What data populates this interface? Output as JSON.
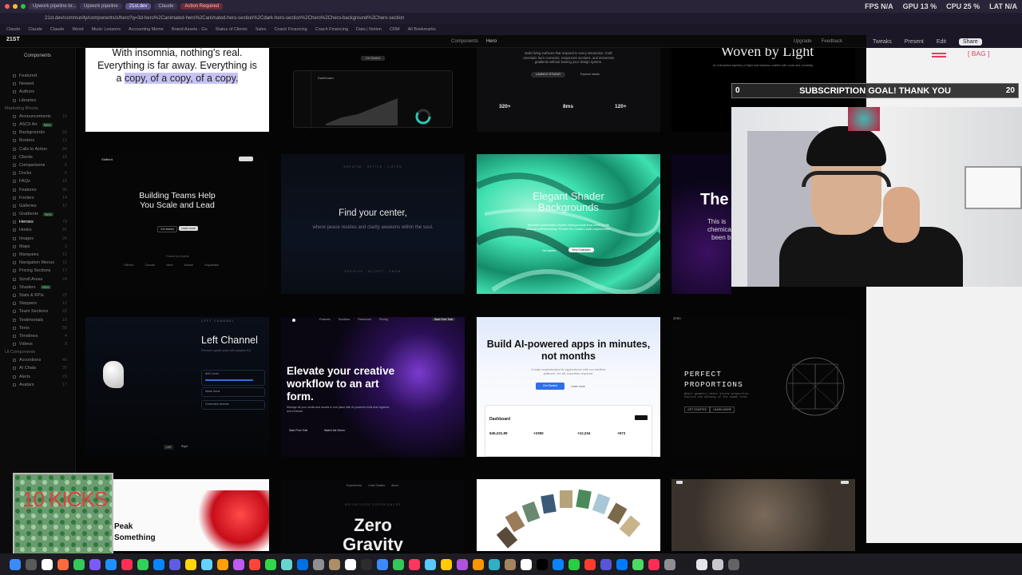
{
  "browser": {
    "tabs": [
      "Upwork pipeline br...",
      "Upwork pipeline",
      "21st.dev",
      "Claude",
      "Action Required"
    ],
    "address": "21st.dev/community/components/s/hero?q=3d-hero%2Canimated-hero%2Canimated-hero-section%2Cdark-hero-section%2Chero%2Chero-background%2Chero-section",
    "bookmarks": [
      "Claude",
      "Claude",
      "Claude",
      "Weird",
      "Music Lessons",
      "Accounting Meme",
      "Brand Assets - Go",
      "Status of Clients",
      "Sales",
      "Coach Financing",
      "Coach Financing",
      "Data | Notion",
      "CRM",
      "All Bookmarks"
    ],
    "stats": {
      "fps": "FPS N/A",
      "gpu": "GPU 13 %",
      "cpu": "CPU 25 %",
      "lat": "LAT N/A"
    }
  },
  "site": {
    "logo": "21ST",
    "breadcrumb": [
      "Components",
      "Hero"
    ],
    "header_right": [
      "Upgrade",
      "Feedback"
    ]
  },
  "sidebar": {
    "top_label": "Components",
    "items": [
      {
        "label": "Featured"
      },
      {
        "label": "Newest"
      },
      {
        "label": "Authors"
      },
      {
        "label": "Libraries"
      }
    ],
    "section_marketing": "Marketing Blocks",
    "marketing": [
      {
        "label": "Announcements",
        "count": "10"
      },
      {
        "label": "ASCII Art",
        "badge": "New"
      },
      {
        "label": "Backgrounds",
        "count": "33"
      },
      {
        "label": "Borders",
        "count": "12"
      },
      {
        "label": "Calls to Action",
        "count": "34"
      },
      {
        "label": "Clients",
        "count": "16"
      },
      {
        "label": "Comparisons",
        "count": "6"
      },
      {
        "label": "Docks",
        "count": "6"
      },
      {
        "label": "FAQs",
        "count": "18"
      },
      {
        "label": "Features",
        "count": "36"
      },
      {
        "label": "Footers",
        "count": "14"
      },
      {
        "label": "Galleries",
        "count": "12"
      },
      {
        "label": "Gradients",
        "badge": "New"
      },
      {
        "label": "Heroes",
        "count": "73",
        "active": true
      },
      {
        "label": "Hooks",
        "count": "31"
      },
      {
        "label": "Images",
        "count": "26"
      },
      {
        "label": "Maps",
        "count": "2"
      },
      {
        "label": "Marquees",
        "count": "12"
      },
      {
        "label": "Navigation Menus",
        "count": "11"
      },
      {
        "label": "Pricing Sections",
        "count": "17"
      },
      {
        "label": "Scroll Areas",
        "count": "24"
      },
      {
        "label": "Shaders",
        "badge": "New"
      },
      {
        "label": "Stats & KPIs",
        "count": "22"
      },
      {
        "label": "Steppers",
        "count": "12"
      },
      {
        "label": "Team Sections",
        "count": "22"
      },
      {
        "label": "Testimonials",
        "count": "15"
      },
      {
        "label": "Texts",
        "count": "58"
      },
      {
        "label": "Timelines",
        "count": "4"
      },
      {
        "label": "Videos",
        "count": "8"
      }
    ],
    "section_ui": "UI Components",
    "ui": [
      {
        "label": "Accordions",
        "count": "40"
      },
      {
        "label": "AI Chats",
        "count": "30"
      },
      {
        "label": "Alerts",
        "count": "23"
      },
      {
        "label": "Avatars",
        "count": "17"
      }
    ]
  },
  "cards": {
    "r0c0": {
      "line1": "With insomnia, nothing's real.",
      "line2": "Everything is far away. Everything is",
      "line3a": "a ",
      "line3b": "copy, of a copy, of a copy."
    },
    "r0c1": {
      "badge": "Get Started",
      "title": "Dashboard"
    },
    "r0c2": {
      "sub1": "Build living surfaces that respond to every interaction. Craft",
      "sub2": "cinematic hero moments, responsive sections, and immersive",
      "sub3": "gradients without leaving your design system.",
      "btn": "LAUNCH STUDIO",
      "link": "Explore studio",
      "stat1": "320+",
      "stat2": "8ms",
      "stat3": "120+"
    },
    "r0c3": {
      "title": "Woven by Light",
      "sub": "An interactive tapestry of light and shadow, crafted with code and creativity."
    },
    "r1c0": {
      "brand": "Stafford",
      "title1": "Building Teams Help",
      "title2": "You Scale and Lead",
      "btn1": "Get started",
      "btn2": "Learn more",
      "trusted": "Trusted by experts",
      "logos": [
        "GitHub",
        "Claude",
        "clerk",
        "Notion",
        "Supabase"
      ]
    },
    "r1c1": {
      "top": "BREATHE · SETTLE · LISTEN",
      "title": "Find your center,",
      "sub": "where peace resides and clarity awakens within the soul.",
      "foot": "BREATHE · ACCEPT · GROW"
    },
    "r1c2": {
      "title1": "Elegant Shader",
      "title2": "Backgrounds",
      "sub1": "Beautiful performant shader backgrounds that come to life",
      "sub2": "without overwhelming. Perfect for modern web experiences.",
      "btn1": "Get started",
      "btn2": "View Examples"
    },
    "r1c3": {
      "title": "The",
      "sub1": "This is chemical",
      "sub2": "been b"
    },
    "r2c0": {
      "eyebrow": "LEFT CHANNEL",
      "title": "Left Channel",
      "sub": "Premium spatial audio with adaptive EQ",
      "row1": "ANC Level",
      "row2": "Noise focus",
      "row3": "Connected devices",
      "tab1": "Left",
      "tab2": "Right"
    },
    "r2c1": {
      "nav": [
        "Features",
        "Solutions",
        "Resources",
        "Pricing"
      ],
      "cta": "Start Free Trial",
      "title1": "Elevate your creative",
      "title2": "workflow to an art",
      "title3": "form.",
      "body": "Manage all your media and assets in one place with AI-powered tools that organize and enhance.",
      "btn1": "Start Free Trial",
      "btn2": "Watch the Demo"
    },
    "r2c2": {
      "title1": "Build AI-powered apps in minutes,",
      "title2": "not months",
      "sub1": "Create sophisticated AI applications with our intuitive",
      "sub2": "platform. No ML expertise required.",
      "btn1": "Get Started",
      "btn2": "Learn more",
      "dash": "Dashboard",
      "kpi1": "$45,231.89",
      "kpi2": "+2350",
      "kpi3": "+12,234",
      "kpi4": "+573"
    },
    "r2c3": {
      "brand": "ZERO",
      "title1": "PERFECT",
      "title2": "PROPORTIONS",
      "sub": "Where geometry meets divine proportion. Explore the harmony of the human form.",
      "btn1": "GET STARTED",
      "btn2": "LEARN MORE"
    },
    "r3c0": {
      "title": "Peak",
      "sub": "Something"
    },
    "r3c1": {
      "nav": [
        "Experiences",
        "Case Studies",
        "About"
      ],
      "eyebrow": "WEIGHTLESS EXPERIENCES",
      "title1": "Zero",
      "title2": "Gravity"
    },
    "r3c2": {},
    "r3c3": {}
  },
  "rightpanel": {
    "items": [
      "Tweaks",
      "Present",
      "Edit"
    ],
    "share": "Share",
    "bag": "[ BAG ]"
  },
  "overlay": {
    "goal_left": "0",
    "goal_text": "SUBSCRIPTION GOAL! THANK YOU",
    "goal_right": "20",
    "kicks": "10 KICKS"
  },
  "colors": {
    "highlight": "#c7c2f5",
    "shader_green": "#3fe0b0",
    "link_blue": "#2f6fe8"
  }
}
